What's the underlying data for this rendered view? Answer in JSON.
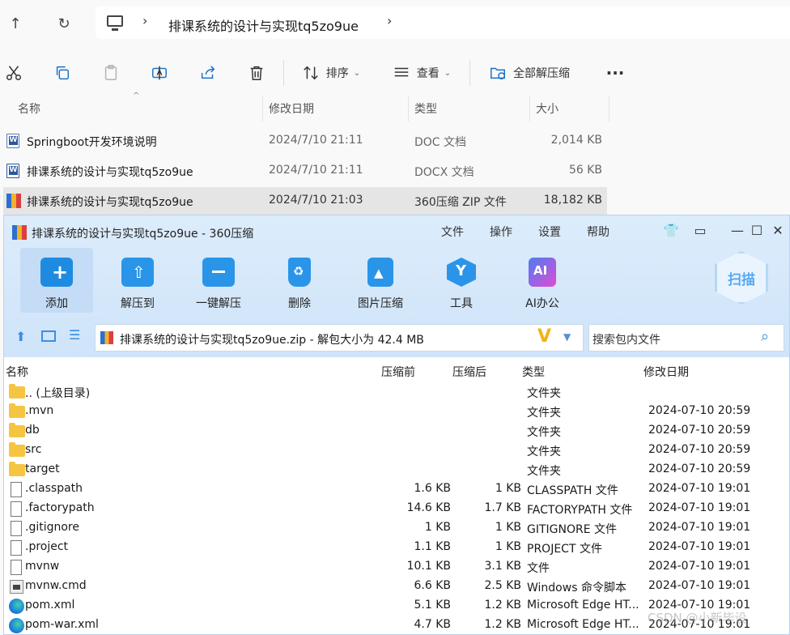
{
  "explorer": {
    "breadcrumb": "排课系统的设计与实现tq5zo9ue",
    "toolbar": {
      "sort": "排序",
      "view": "查看",
      "extract_all": "全部解压缩"
    },
    "columns": {
      "name": "名称",
      "date": "修改日期",
      "type": "类型",
      "size": "大小"
    },
    "files": [
      {
        "name": "Springboot开发环境说明",
        "date": "2024/7/10 21:11",
        "type": "DOC 文档",
        "size": "2,014 KB"
      },
      {
        "name": "排课系统的设计与实现tq5zo9ue",
        "date": "2024/7/10 21:11",
        "type": "DOCX 文档",
        "size": "56 KB"
      },
      {
        "name": "排课系统的设计与实现tq5zo9ue",
        "date": "2024/7/10 21:03",
        "type": "360压缩 ZIP 文件",
        "size": "18,182 KB"
      }
    ]
  },
  "zip": {
    "title": "排课系统的设计与实现tq5zo9ue - 360压缩",
    "menu": [
      "文件",
      "操作",
      "设置",
      "帮助"
    ],
    "tools": [
      "添加",
      "解压到",
      "一键解压",
      "删除",
      "图片压缩",
      "工具",
      "AI办公"
    ],
    "scan": "扫描",
    "path": "排课系统的设计与实现tq5zo9ue.zip - 解包大小为 42.4 MB",
    "search_placeholder": "搜索包内文件",
    "columns": {
      "name": "名称",
      "before": "压缩前",
      "after": "压缩后",
      "type": "类型",
      "date": "修改日期"
    },
    "rows": [
      {
        "icon": "folder",
        "name": ".. (上级目录)",
        "before": "",
        "after": "",
        "type": "文件夹",
        "date": ""
      },
      {
        "icon": "folder",
        "name": ".mvn",
        "before": "",
        "after": "",
        "type": "文件夹",
        "date": "2024-07-10 20:59"
      },
      {
        "icon": "folder",
        "name": "db",
        "before": "",
        "after": "",
        "type": "文件夹",
        "date": "2024-07-10 20:59"
      },
      {
        "icon": "folder",
        "name": "src",
        "before": "",
        "after": "",
        "type": "文件夹",
        "date": "2024-07-10 20:59"
      },
      {
        "icon": "folder",
        "name": "target",
        "before": "",
        "after": "",
        "type": "文件夹",
        "date": "2024-07-10 20:59"
      },
      {
        "icon": "file",
        "name": ".classpath",
        "before": "1.6 KB",
        "after": "1 KB",
        "type": "CLASSPATH 文件",
        "date": "2024-07-10 19:01"
      },
      {
        "icon": "file",
        "name": ".factorypath",
        "before": "14.6 KB",
        "after": "1.7 KB",
        "type": "FACTORYPATH 文件",
        "date": "2024-07-10 19:01"
      },
      {
        "icon": "file",
        "name": ".gitignore",
        "before": "1 KB",
        "after": "1 KB",
        "type": "GITIGNORE 文件",
        "date": "2024-07-10 19:01"
      },
      {
        "icon": "file",
        "name": ".project",
        "before": "1.1 KB",
        "after": "1 KB",
        "type": "PROJECT 文件",
        "date": "2024-07-10 19:01"
      },
      {
        "icon": "file",
        "name": "mvnw",
        "before": "10.1 KB",
        "after": "3.1 KB",
        "type": "文件",
        "date": "2024-07-10 19:01"
      },
      {
        "icon": "cmd",
        "name": "mvnw.cmd",
        "before": "6.6 KB",
        "after": "2.5 KB",
        "type": "Windows 命令脚本",
        "date": "2024-07-10 19:01"
      },
      {
        "icon": "edge",
        "name": "pom.xml",
        "before": "5.1 KB",
        "after": "1.2 KB",
        "type": "Microsoft Edge HT...",
        "date": "2024-07-10 19:01"
      },
      {
        "icon": "edge",
        "name": "pom-war.xml",
        "before": "4.7 KB",
        "after": "1.2 KB",
        "type": "Microsoft Edge HT...",
        "date": "2024-07-10 19:01"
      }
    ]
  },
  "watermark": "CSDN @小新毕设"
}
